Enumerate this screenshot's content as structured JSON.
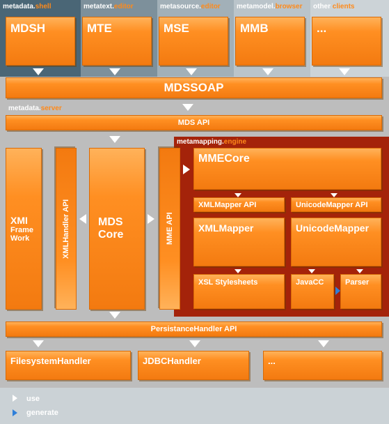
{
  "colors": {
    "box_orange": "#f7861a",
    "box_border": "#d96a05",
    "server_bg": "#bdbdbd",
    "engine_bg": "#a4230a",
    "client_band_1": "#4a6676",
    "client_band_2": "#7d909b",
    "client_band_3": "#a2b0b8",
    "client_band_4": "#bac4ca",
    "client_band_5": "#ccd3d7",
    "legend_bg": "#cbd2d6",
    "use_arrow": "#ffffff",
    "generate_arrow": "#2f7fd9",
    "caption_highlight": "#ff8a1a"
  },
  "clients": [
    {
      "caption_main": "metadata.",
      "caption_hl": "shell",
      "box": "MDSH"
    },
    {
      "caption_main": "metatext.",
      "caption_hl": "editor",
      "box": "MTE"
    },
    {
      "caption_main": "metasource.",
      "caption_hl": "editor",
      "box": "MSE"
    },
    {
      "caption_main": "metamodel.",
      "caption_hl": "browser",
      "box": "MMB"
    },
    {
      "caption_main": "other ",
      "caption_hl": "clients",
      "box": "..."
    }
  ],
  "mdssoap": "MDSSOAP",
  "server_caption": {
    "main": "metadata.",
    "hl": "server"
  },
  "mds_api": "MDS API",
  "xmi_framework": [
    "XMI",
    "Frame",
    "Work"
  ],
  "xmlhandler_api": "XMLHandler API",
  "mds_core": [
    "MDS",
    "Core"
  ],
  "mme_api": "MME API",
  "engine_caption": {
    "main": "metamapping.",
    "hl": "engine"
  },
  "mmecore": "MMECore",
  "xmlmapper_api": "XMLMapper API",
  "unicodemapper_api": "UnicodeMapper API",
  "xmlmapper": "XMLMapper",
  "unicodemapper": "UnicodeMapper",
  "xsl_stylesheets": "XSL Stylesheets",
  "javacc": "JavaCC",
  "parser": "Parser",
  "persistance_api": "PersistanceHandler API",
  "filesystem_handler": "FilesystemHandler",
  "jdbc_handler": "JDBCHandler",
  "other_handler": "...",
  "legend": {
    "use": "use",
    "generate": "generate"
  }
}
